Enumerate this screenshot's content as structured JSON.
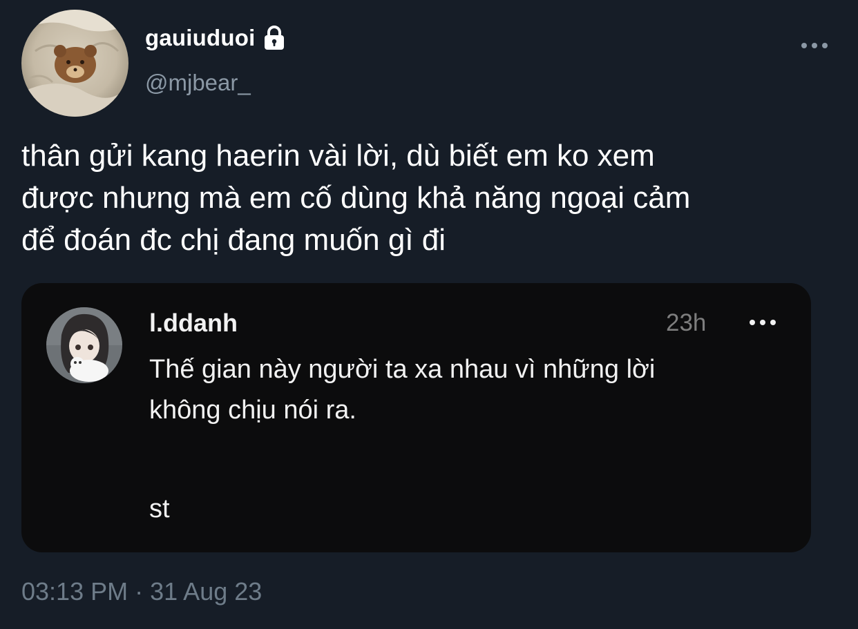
{
  "author": {
    "display_name": "gauiuduoi",
    "handle": "@mjbear_",
    "protected_icon": "lock-icon",
    "more_icon": "more-horizontal-icon"
  },
  "tweet": {
    "lines": [
      "thân gửi kang haerin vài lời, dù biết em ko xem",
      "được nhưng mà em cố dùng khả năng ngoại cảm",
      "để đoán đc chị đang muốn gì đi"
    ]
  },
  "quoted_post": {
    "username": "l.ddanh",
    "time": "23h",
    "more_icon": "more-horizontal-icon",
    "lines": [
      "Thế gian này người ta xa nhau vì những lời",
      "không chịu nói ra."
    ],
    "footer": "st"
  },
  "meta": {
    "time": "03:13 PM",
    "separator": "·",
    "date": "31 Aug 23"
  },
  "colors": {
    "background": "#161d27",
    "text_primary": "#ffffff",
    "text_secondary": "#8b98a5",
    "card_background": "#0c0c0d"
  }
}
